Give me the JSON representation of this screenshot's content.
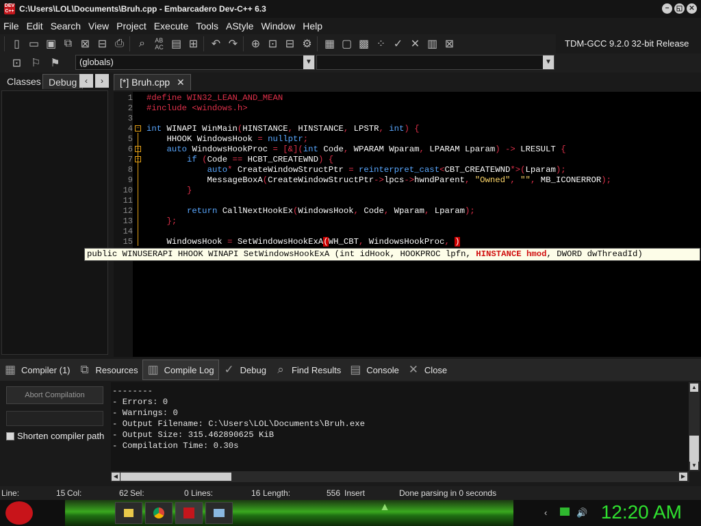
{
  "window": {
    "title": "C:\\Users\\LOL\\Documents\\Bruh.cpp - Embarcadero Dev-C++ 6.3",
    "app_icon_text": "DEV C++",
    "controls": [
      "−",
      "◱",
      "✕"
    ]
  },
  "menu": [
    "File",
    "Edit",
    "Search",
    "View",
    "Project",
    "Execute",
    "Tools",
    "AStyle",
    "Window",
    "Help"
  ],
  "toolbar": {
    "compiler": "TDM-GCC 9.2.0 32-bit Release",
    "scope": "(globals)"
  },
  "left_panel": {
    "tabs": [
      "Classes",
      "Debug"
    ],
    "active_tab": "Debug",
    "prev": "‹",
    "next": "›"
  },
  "editor": {
    "tab_label": "[*] Bruh.cpp",
    "tab_close": "✕",
    "line_numbers": [
      "1",
      "2",
      "3",
      "4",
      "5",
      "6",
      "7",
      "8",
      "9",
      "10",
      "11",
      "12",
      "13",
      "14",
      "15"
    ],
    "lines": [
      "#define WIN32_LEAN_AND_MEAN",
      "#include <windows.h>",
      "",
      "int WINAPI WinMain(HINSTANCE, HINSTANCE, LPSTR, int) {",
      "    HHOOK WindowsHook = nullptr;",
      "    auto WindowsHookProc = [&](int Code, WPARAM Wparam, LPARAM Lparam) -> LRESULT {",
      "        if (Code == HCBT_CREATEWND) {",
      "            auto* CreateWindowStructPtr = reinterpret_cast<CBT_CREATEWND*>(Lparam);",
      "            MessageBoxA(CreateWindowStructPtr->lpcs->hwndParent, \"Owned\", \"\", MB_ICONERROR);",
      "        }",
      "",
      "        return CallNextHookEx(WindowsHook, Code, Wparam, Lparam);",
      "    };",
      "",
      "    WindowsHook = SetWindowsHookExA(WH_CBT, WindowsHookProc, )"
    ],
    "hint_before": "public WINUSERAPI HHOOK WINAPI SetWindowsHookExA (int idHook, HOOKPROC lpfn, ",
    "hint_current": "HINSTANCE hmod",
    "hint_after": ", DWORD dwThreadId)"
  },
  "bottom_tabs": [
    "Compiler (1)",
    "Resources",
    "Compile Log",
    "Debug",
    "Find Results",
    "Console",
    "Close"
  ],
  "bottom_active": "Compile Log",
  "compile_panel": {
    "abort_label": "Abort Compilation",
    "shorten_label": "Shorten compiler path"
  },
  "compile_log": [
    "--------",
    "- Errors: 0",
    "- Warnings: 0",
    "- Output Filename: C:\\Users\\LOL\\Documents\\Bruh.exe",
    "- Output Size: 315.462890625 KiB",
    "- Compilation Time: 0.30s"
  ],
  "status": {
    "line_label": "Line:",
    "line_value": "15",
    "col_label": "Col:",
    "col_value": "62",
    "sel_label": "Sel:",
    "sel_value": "0",
    "lines_label": "Lines:",
    "lines_value": "16",
    "length_label": "Length:",
    "length_value": "556",
    "mode": "Insert",
    "message": "Done parsing in 0 seconds"
  },
  "taskbar": {
    "clock": "12:20 AM"
  },
  "colors": {
    "preprocessor": "#e0304a",
    "keyword": "#5aa8ff",
    "string": "#ffd86a",
    "clock": "#2fe02f",
    "taskbar_accent": "#3aa81f"
  }
}
